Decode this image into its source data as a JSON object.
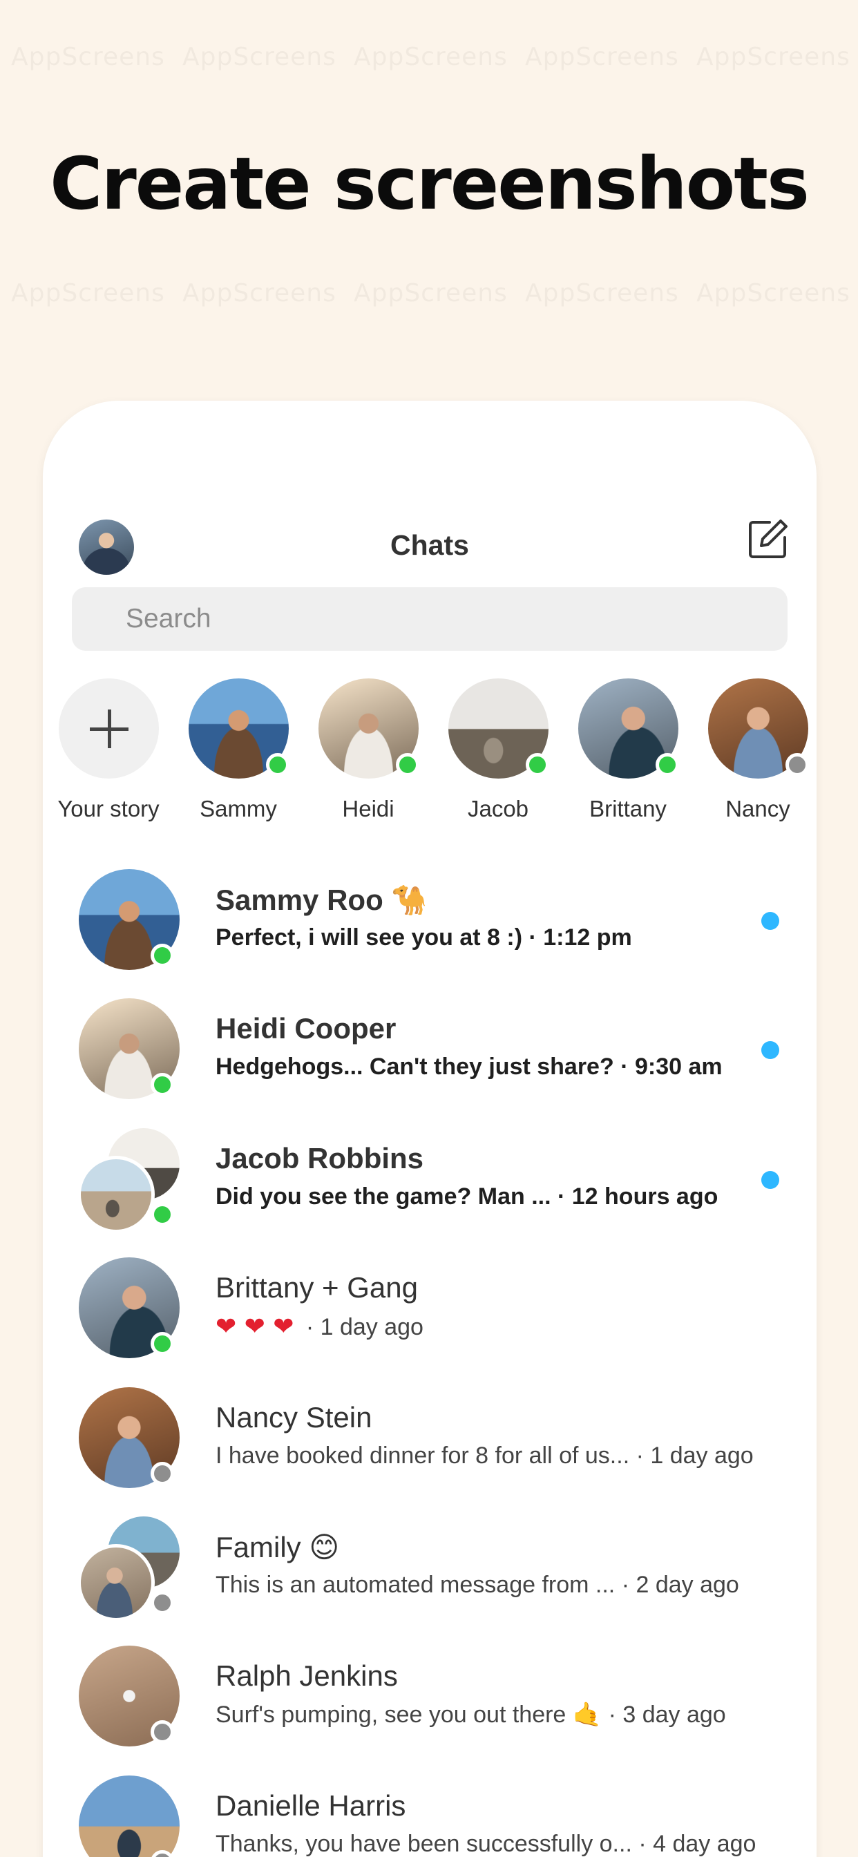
{
  "watermark_text": "AppScreens",
  "headline": "Create screenshots",
  "header": {
    "title": "Chats",
    "profile_icon": "profile-avatar",
    "compose_icon": "compose-icon"
  },
  "search": {
    "placeholder": "Search"
  },
  "stories": [
    {
      "name": "Your story",
      "type": "add"
    },
    {
      "name": "Sammy",
      "online": true
    },
    {
      "name": "Heidi",
      "online": true
    },
    {
      "name": "Jacob",
      "online": true
    },
    {
      "name": "Brittany",
      "online": true
    },
    {
      "name": "Nancy",
      "online": false
    }
  ],
  "chats": [
    {
      "name": "Sammy Roo",
      "name_emoji": "🐪",
      "message": "Perfect, i will see you at 8 :)",
      "time": "· 1:12 pm",
      "unread": true,
      "online": true,
      "group": false
    },
    {
      "name": "Heidi Cooper",
      "message": "Hedgehogs... Can't they just share?",
      "time": "· 9:30 am",
      "unread": true,
      "online": true,
      "group": false
    },
    {
      "name": "Jacob Robbins",
      "message": "Did you see the game? Man ...",
      "time": "· 12 hours ago",
      "unread": true,
      "online": true,
      "group": true
    },
    {
      "name": "Brittany + Gang",
      "message": "❤ ❤ ❤",
      "time": "· 1 day ago",
      "unread": false,
      "online": true,
      "group": false
    },
    {
      "name": "Nancy Stein",
      "message": "I have booked dinner for 8 for all of us...",
      "time": "· 1 day ago",
      "unread": false,
      "online": false,
      "group": false
    },
    {
      "name": "Family",
      "name_emoji": "😊",
      "message": "This is an automated message from ...",
      "time": "· 2 day ago",
      "unread": false,
      "online": false,
      "group": true
    },
    {
      "name": "Ralph Jenkins",
      "message": "Surf's pumping, see you out there 🤙",
      "time": "· 3 day ago",
      "unread": false,
      "online": false,
      "group": false
    },
    {
      "name": "Danielle Harris",
      "message": "Thanks, you have been successfully o...",
      "time": "· 4 day ago",
      "unread": false,
      "online": false,
      "group": false
    }
  ],
  "colors": {
    "background": "#fcf4ea",
    "online": "#31cc46",
    "offline": "#8e8e8e",
    "unread_dot": "#2eb7ff"
  }
}
